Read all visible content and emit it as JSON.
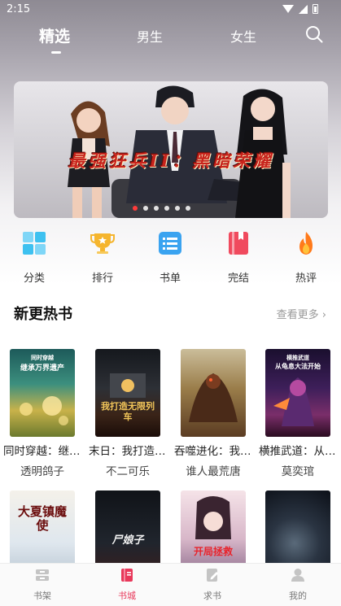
{
  "status_bar": {
    "time": "2:15"
  },
  "tabs": [
    {
      "label": "精选",
      "active": true
    },
    {
      "label": "男生",
      "active": false
    },
    {
      "label": "女生",
      "active": false
    }
  ],
  "banner": {
    "title": "最强狂兵II：黑暗荣耀",
    "slide_count": 6,
    "active_slide": 1
  },
  "categories": [
    {
      "label": "分类",
      "icon": "grid-icon",
      "color": "#3ec1f0"
    },
    {
      "label": "排行",
      "icon": "trophy-icon",
      "color": "#f5b52e"
    },
    {
      "label": "书单",
      "icon": "list-icon",
      "color": "#3aa3f0"
    },
    {
      "label": "完结",
      "icon": "bookmark-book-icon",
      "color": "#f04a5e"
    },
    {
      "label": "热评",
      "icon": "flame-icon",
      "color": "#ff7a1a"
    }
  ],
  "section": {
    "title": "新更热书",
    "more": "查看更多"
  },
  "books_row1": [
    {
      "title": "同时穿越：继…",
      "author": "透明鸽子",
      "cover_text": "继承万界遗产",
      "cover_tag": "同时穿越"
    },
    {
      "title": "末日：我打造…",
      "author": "不二可乐",
      "cover_text": "我打造无限列车",
      "cover_tag": ""
    },
    {
      "title": "吞噬进化：我…",
      "author": "谁人最荒唐",
      "cover_text": "",
      "cover_tag": ""
    },
    {
      "title": "横推武道：从…",
      "author": "莫奕琯",
      "cover_text": "从龟息大法开始",
      "cover_tag": "横推武道"
    }
  ],
  "books_row2": [
    {
      "cover_text": "大夏镇魔使"
    },
    {
      "cover_text": "尸娘子"
    },
    {
      "cover_text": "开局拯救"
    },
    {
      "cover_text": ""
    }
  ],
  "bottom_nav": [
    {
      "label": "书架",
      "icon": "bookshelf-icon",
      "active": false
    },
    {
      "label": "书城",
      "icon": "bookstore-icon",
      "active": true
    },
    {
      "label": "求书",
      "icon": "request-book-icon",
      "active": false
    },
    {
      "label": "我的",
      "icon": "profile-icon",
      "active": false
    }
  ],
  "colors": {
    "accent": "#e8385a",
    "banner_title": "#c8231c"
  }
}
